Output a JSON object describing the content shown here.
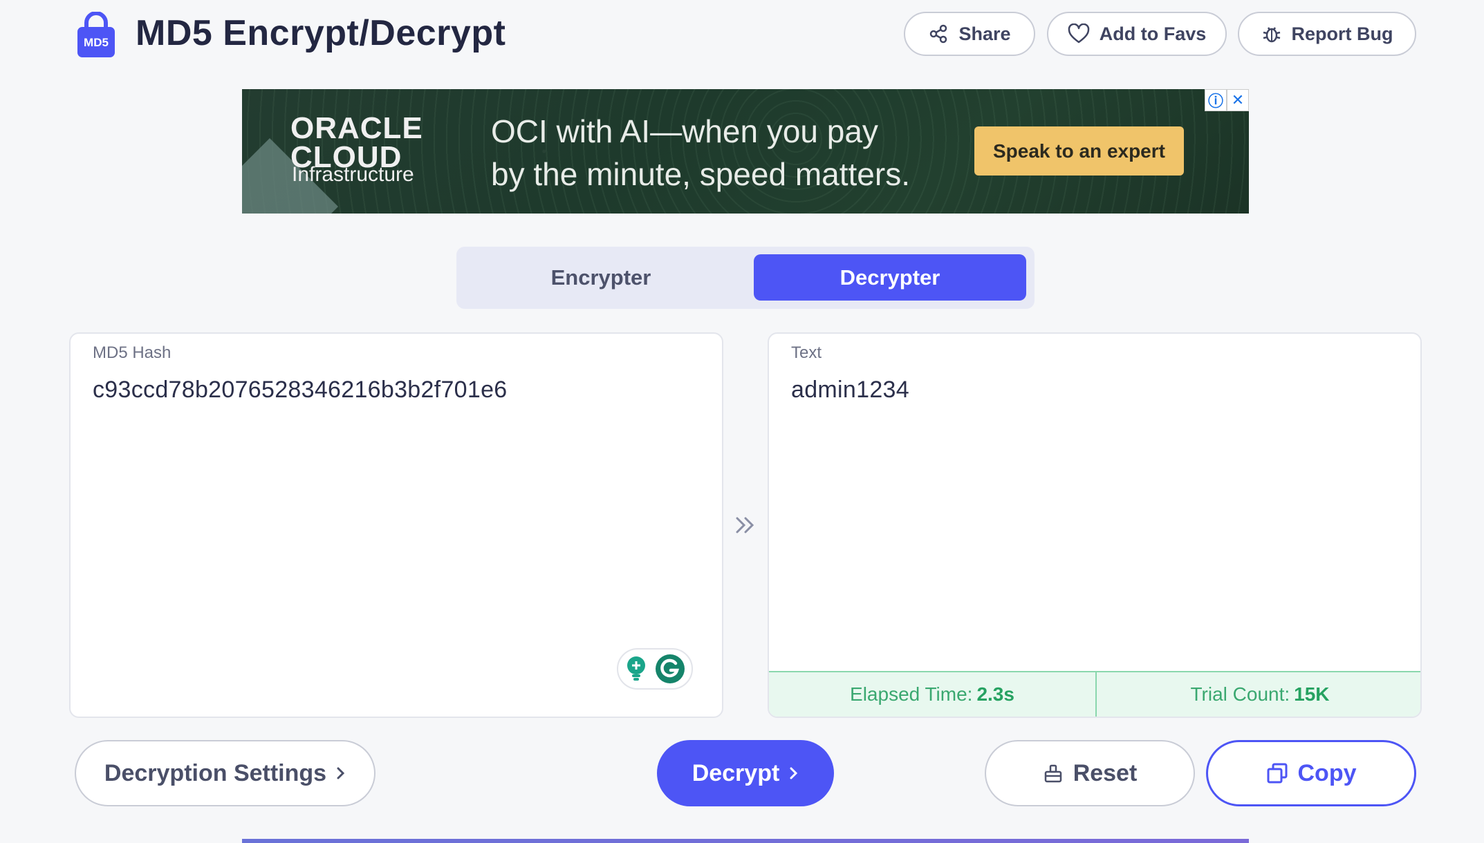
{
  "header": {
    "logo_text": "MD5",
    "title": "MD5 Encrypt/Decrypt",
    "share_label": "Share",
    "favs_label": "Add to Favs",
    "bug_label": "Report Bug"
  },
  "ad": {
    "brand_line1": "ORACLE",
    "brand_line2": "CLOUD",
    "brand_line3": "Infrastructure",
    "headline_1": "OCI with AI—when you pay",
    "headline_2": "by the minute, speed matters.",
    "cta": "Speak to an expert",
    "info_icon": "ⓘ",
    "close_icon": "✕"
  },
  "tabs": {
    "encrypter": "Encrypter",
    "decrypter": "Decrypter",
    "active": "decrypter"
  },
  "input_panel": {
    "label": "MD5 Hash",
    "value": "c93ccd78b2076528346216b3b2f701e6"
  },
  "output_panel": {
    "label": "Text",
    "value": "admin1234",
    "elapsed_label": "Elapsed Time:",
    "elapsed_value": "2.3s",
    "trial_label": "Trial Count:",
    "trial_value": "15K"
  },
  "buttons": {
    "settings": "Decryption Settings",
    "decrypt": "Decrypt",
    "reset": "Reset",
    "copy": "Copy"
  },
  "colors": {
    "accent": "#4d55f5",
    "success": "#26a261",
    "success_bg": "#e8f8ef"
  }
}
